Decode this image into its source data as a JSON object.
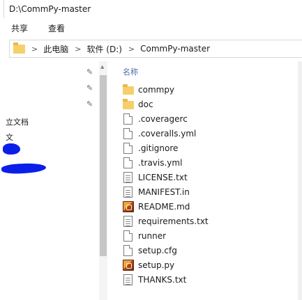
{
  "window": {
    "title": "D:\\CommPy-master"
  },
  "ribbon": {
    "tabs": [
      "共享",
      "查看"
    ]
  },
  "address": {
    "crumbs": [
      "此电脑",
      "软件 (D:)",
      "CommPy-master"
    ],
    "separator": ">"
  },
  "nav": {
    "pin_glyph": "✎",
    "items": [
      "立文档",
      "文"
    ],
    "scroll_up_glyph": "▲"
  },
  "files": {
    "column_header": "名称",
    "items": [
      {
        "name": "commpy",
        "icon": "folder-icon"
      },
      {
        "name": "doc",
        "icon": "folder-icon"
      },
      {
        "name": ".coveragerc",
        "icon": "file-icon"
      },
      {
        "name": ".coveralls.yml",
        "icon": "file-icon"
      },
      {
        "name": ".gitignore",
        "icon": "file-icon"
      },
      {
        "name": ".travis.yml",
        "icon": "file-icon"
      },
      {
        "name": "LICENSE.txt",
        "icon": "text-file-icon"
      },
      {
        "name": "MANIFEST.in",
        "icon": "text-file-icon"
      },
      {
        "name": "README.md",
        "icon": "python-file-icon"
      },
      {
        "name": "requirements.txt",
        "icon": "text-file-icon"
      },
      {
        "name": "runner",
        "icon": "file-icon"
      },
      {
        "name": "setup.cfg",
        "icon": "file-icon"
      },
      {
        "name": "setup.py",
        "icon": "python-file-icon"
      },
      {
        "name": "THANKS.txt",
        "icon": "text-file-icon"
      }
    ]
  }
}
